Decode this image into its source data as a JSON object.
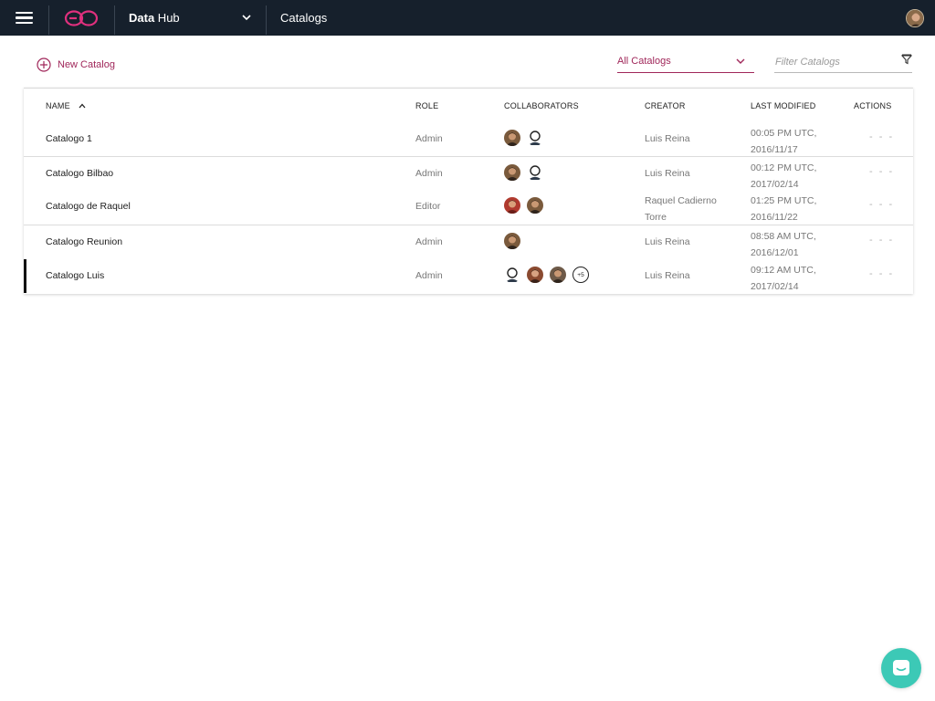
{
  "topbar": {
    "product_name_bold": "Data",
    "product_name_rest": " Hub",
    "page": "Catalogs",
    "icons": {
      "menu": "hamburger-icon",
      "logo": "logo-icon",
      "product_dropdown": "chevron-down-icon",
      "user": "user-avatar"
    }
  },
  "toolbar": {
    "new_catalog_label": "New Catalog",
    "catalog_select_value": "All Catalogs",
    "filter_placeholder": "Filter Catalogs",
    "filter_value": ""
  },
  "table": {
    "columns": [
      "NAME",
      "ROLE",
      "COLLABORATORS",
      "CREATOR",
      "LAST MODIFIED",
      "ACTIONS"
    ],
    "sorted_column": "NAME",
    "sort_direction": "ascending",
    "rows": [
      {
        "name": "Catalogo 1",
        "role": "Admin",
        "collaborators": [
          "photo",
          "placeholder"
        ],
        "creator": [
          "Luis Reina"
        ],
        "modified": [
          "00:05 PM UTC,",
          "2016/11/17"
        ],
        "actions": "- - -"
      },
      {
        "name": "Catalogo Bilbao",
        "role": "Admin",
        "collaborators": [
          "photo",
          "placeholder"
        ],
        "creator": [
          "Luis Reina"
        ],
        "modified": [
          "00:12 PM UTC,",
          "2017/02/14"
        ],
        "actions": "- - -"
      },
      {
        "name": "Catalogo de Raquel",
        "role": "Editor",
        "collaborators": [
          "photo-red",
          "photo"
        ],
        "creator": [
          "Raquel Cadierno",
          "Torre"
        ],
        "modified": [
          "01:25 PM UTC,",
          "2016/11/22"
        ],
        "actions": "- - -"
      },
      {
        "name": "Catalogo Reunion",
        "role": "Admin",
        "collaborators": [
          "photo"
        ],
        "creator": [
          "Luis Reina"
        ],
        "modified": [
          "08:58 AM UTC,",
          "2016/12/01"
        ],
        "actions": "- - -"
      },
      {
        "name": "Catalogo Luis",
        "role": "Admin",
        "collaborators": [
          "placeholder",
          "photo",
          "photo"
        ],
        "collaborators_more": "+5",
        "creator": [
          "Luis Reina"
        ],
        "modified": [
          "09:12 AM UTC,",
          "2017/02/14"
        ],
        "actions": "- - -",
        "selected": true
      }
    ]
  },
  "colors": {
    "topbar_bg": "#16202c",
    "accent": "#a0275a",
    "logo": "#e0307e",
    "chat": "#3cc9b6"
  }
}
